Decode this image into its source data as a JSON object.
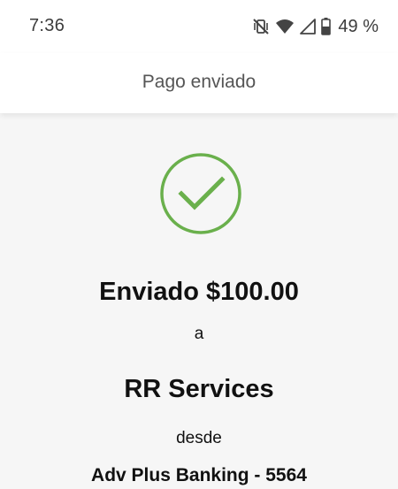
{
  "status_bar": {
    "time": "7:36",
    "battery_text": "49 %",
    "icons": [
      "vibrate-off-icon",
      "wifi-icon",
      "signal-icon",
      "battery-icon"
    ]
  },
  "header": {
    "title": "Pago enviado"
  },
  "confirmation": {
    "icon": "checkmark-circle-icon",
    "accent_color": "#6ab04c",
    "sent_amount": "Enviado $100.00",
    "to_word": "a",
    "recipient": "RR Services",
    "from_word": "desde",
    "account": "Adv Plus Banking - 5564"
  }
}
